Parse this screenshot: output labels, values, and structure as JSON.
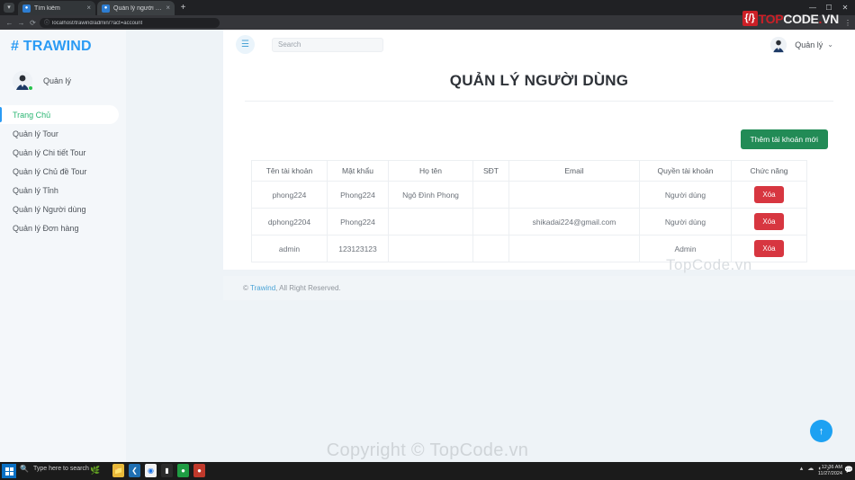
{
  "browser": {
    "tabs": [
      {
        "title": "Tìm kiếm",
        "favicon": "search-favicon",
        "close": "×"
      },
      {
        "title": "Quản lý người dùng",
        "favicon": "app-favicon",
        "close": "×"
      }
    ],
    "new_tab_label": "+",
    "window_controls": {
      "minimize": "—",
      "maximize": "☐",
      "close": "✕"
    },
    "nav": {
      "back": "←",
      "forward": "→",
      "reload": "⟳"
    },
    "omnibox": {
      "url": "localhost/trawind/admin/?act=account",
      "lock_icon": "info-circle-icon"
    },
    "kebab_label": "⋮",
    "logo": {
      "mark": "{/}",
      "top": "TOP",
      "code": "CODE",
      "dot": ".",
      "vn": "VN"
    }
  },
  "sidebar": {
    "brand": "# TRAWIND",
    "profile_name": "Quản lý",
    "items": [
      {
        "label": "Trang Chủ",
        "active": true
      },
      {
        "label": "Quản lý Tour",
        "active": false
      },
      {
        "label": "Quản lý Chi tiết Tour",
        "active": false
      },
      {
        "label": "Quản lý Chủ đề Tour",
        "active": false
      },
      {
        "label": "Quản lý Tỉnh",
        "active": false
      },
      {
        "label": "Quản lý Người dùng",
        "active": false
      },
      {
        "label": "Quản lý Đơn hàng",
        "active": false
      }
    ]
  },
  "topbar": {
    "hamburger_icon": "hamburger-icon",
    "search_placeholder": "Search",
    "search_value": "",
    "user_name": "Quản lý",
    "caret": "⌄"
  },
  "page": {
    "title": "QUẢN LÝ NGƯỜI DÙNG",
    "add_button": "Thêm tài khoản mới",
    "watermark_card": "TopCode.vn",
    "watermark_bottom": "Copyright © TopCode.vn",
    "scroll_top_icon": "↑"
  },
  "table": {
    "headers": [
      "Tên tài khoản",
      "Mật khẩu",
      "Họ tên",
      "SĐT",
      "Email",
      "Quyền tài khoản",
      "Chức năng"
    ],
    "delete_label": "Xóa",
    "rows": [
      {
        "username": "phong224",
        "password": "Phong224",
        "fullname": "Ngô Đình Phong",
        "phone": "",
        "email": "",
        "role": "Người dùng"
      },
      {
        "username": "dphong2204",
        "password": "Phong224",
        "fullname": "",
        "phone": "",
        "email": "shikadai224@gmail.com",
        "role": "Người dùng"
      },
      {
        "username": "admin",
        "password": "123123123",
        "fullname": "",
        "phone": "",
        "email": "",
        "role": "Admin"
      }
    ]
  },
  "footer": {
    "copy_symbol": "©",
    "brand_link": "Trawind",
    "rest": ", All Right Reserved."
  },
  "taskbar": {
    "search_placeholder": "Type here to search",
    "time": "12:36 AM",
    "date": "11/27/2024",
    "icons": [
      "file-explorer-icon",
      "vscode-icon",
      "chrome-icon",
      "terminal-icon",
      "xampp-icon",
      "recorder-icon"
    ],
    "tray": [
      "chevron-up-icon",
      "cloud-icon",
      "network-icon",
      "volume-icon"
    ],
    "notif_icon": "notification-icon"
  },
  "colors": {
    "brand_blue": "#2b9bf4",
    "accent_green": "#228b56",
    "danger_red": "#d73640",
    "active_green": "#2bb673",
    "page_bg": "#eef3f7"
  }
}
